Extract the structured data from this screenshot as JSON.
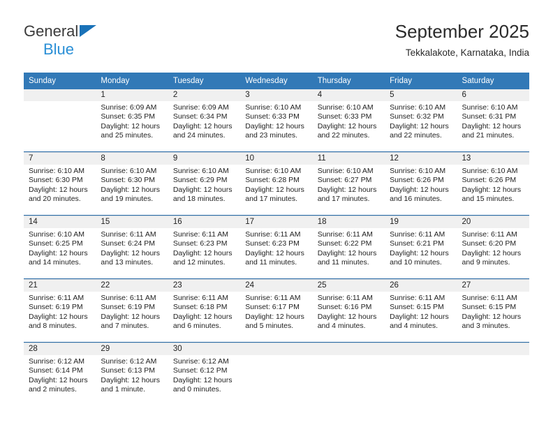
{
  "brand": {
    "name_top": "General",
    "name_bottom": "Blue",
    "triangle_color": "#1a72b8",
    "blue_text_color": "#2a8fd6"
  },
  "header": {
    "title": "September 2025",
    "subtitle": "Tekkalakote, Karnataka, India"
  },
  "theme": {
    "header_row_bg": "#3279b7",
    "header_row_text": "#ffffff",
    "daynum_band_bg": "#f0f0f0",
    "row_divider": "#2a6ca8",
    "cell_border": "#cfd6dc"
  },
  "weekday_headers": [
    "Sunday",
    "Monday",
    "Tuesday",
    "Wednesday",
    "Thursday",
    "Friday",
    "Saturday"
  ],
  "weeks": [
    [
      {
        "day": "",
        "lines": []
      },
      {
        "day": "1",
        "lines": [
          "Sunrise: 6:09 AM",
          "Sunset: 6:35 PM",
          "Daylight: 12 hours",
          "and 25 minutes."
        ]
      },
      {
        "day": "2",
        "lines": [
          "Sunrise: 6:09 AM",
          "Sunset: 6:34 PM",
          "Daylight: 12 hours",
          "and 24 minutes."
        ]
      },
      {
        "day": "3",
        "lines": [
          "Sunrise: 6:10 AM",
          "Sunset: 6:33 PM",
          "Daylight: 12 hours",
          "and 23 minutes."
        ]
      },
      {
        "day": "4",
        "lines": [
          "Sunrise: 6:10 AM",
          "Sunset: 6:33 PM",
          "Daylight: 12 hours",
          "and 22 minutes."
        ]
      },
      {
        "day": "5",
        "lines": [
          "Sunrise: 6:10 AM",
          "Sunset: 6:32 PM",
          "Daylight: 12 hours",
          "and 22 minutes."
        ]
      },
      {
        "day": "6",
        "lines": [
          "Sunrise: 6:10 AM",
          "Sunset: 6:31 PM",
          "Daylight: 12 hours",
          "and 21 minutes."
        ]
      }
    ],
    [
      {
        "day": "7",
        "lines": [
          "Sunrise: 6:10 AM",
          "Sunset: 6:30 PM",
          "Daylight: 12 hours",
          "and 20 minutes."
        ]
      },
      {
        "day": "8",
        "lines": [
          "Sunrise: 6:10 AM",
          "Sunset: 6:30 PM",
          "Daylight: 12 hours",
          "and 19 minutes."
        ]
      },
      {
        "day": "9",
        "lines": [
          "Sunrise: 6:10 AM",
          "Sunset: 6:29 PM",
          "Daylight: 12 hours",
          "and 18 minutes."
        ]
      },
      {
        "day": "10",
        "lines": [
          "Sunrise: 6:10 AM",
          "Sunset: 6:28 PM",
          "Daylight: 12 hours",
          "and 17 minutes."
        ]
      },
      {
        "day": "11",
        "lines": [
          "Sunrise: 6:10 AM",
          "Sunset: 6:27 PM",
          "Daylight: 12 hours",
          "and 17 minutes."
        ]
      },
      {
        "day": "12",
        "lines": [
          "Sunrise: 6:10 AM",
          "Sunset: 6:26 PM",
          "Daylight: 12 hours",
          "and 16 minutes."
        ]
      },
      {
        "day": "13",
        "lines": [
          "Sunrise: 6:10 AM",
          "Sunset: 6:26 PM",
          "Daylight: 12 hours",
          "and 15 minutes."
        ]
      }
    ],
    [
      {
        "day": "14",
        "lines": [
          "Sunrise: 6:10 AM",
          "Sunset: 6:25 PM",
          "Daylight: 12 hours",
          "and 14 minutes."
        ]
      },
      {
        "day": "15",
        "lines": [
          "Sunrise: 6:11 AM",
          "Sunset: 6:24 PM",
          "Daylight: 12 hours",
          "and 13 minutes."
        ]
      },
      {
        "day": "16",
        "lines": [
          "Sunrise: 6:11 AM",
          "Sunset: 6:23 PM",
          "Daylight: 12 hours",
          "and 12 minutes."
        ]
      },
      {
        "day": "17",
        "lines": [
          "Sunrise: 6:11 AM",
          "Sunset: 6:23 PM",
          "Daylight: 12 hours",
          "and 11 minutes."
        ]
      },
      {
        "day": "18",
        "lines": [
          "Sunrise: 6:11 AM",
          "Sunset: 6:22 PM",
          "Daylight: 12 hours",
          "and 11 minutes."
        ]
      },
      {
        "day": "19",
        "lines": [
          "Sunrise: 6:11 AM",
          "Sunset: 6:21 PM",
          "Daylight: 12 hours",
          "and 10 minutes."
        ]
      },
      {
        "day": "20",
        "lines": [
          "Sunrise: 6:11 AM",
          "Sunset: 6:20 PM",
          "Daylight: 12 hours",
          "and 9 minutes."
        ]
      }
    ],
    [
      {
        "day": "21",
        "lines": [
          "Sunrise: 6:11 AM",
          "Sunset: 6:19 PM",
          "Daylight: 12 hours",
          "and 8 minutes."
        ]
      },
      {
        "day": "22",
        "lines": [
          "Sunrise: 6:11 AM",
          "Sunset: 6:19 PM",
          "Daylight: 12 hours",
          "and 7 minutes."
        ]
      },
      {
        "day": "23",
        "lines": [
          "Sunrise: 6:11 AM",
          "Sunset: 6:18 PM",
          "Daylight: 12 hours",
          "and 6 minutes."
        ]
      },
      {
        "day": "24",
        "lines": [
          "Sunrise: 6:11 AM",
          "Sunset: 6:17 PM",
          "Daylight: 12 hours",
          "and 5 minutes."
        ]
      },
      {
        "day": "25",
        "lines": [
          "Sunrise: 6:11 AM",
          "Sunset: 6:16 PM",
          "Daylight: 12 hours",
          "and 4 minutes."
        ]
      },
      {
        "day": "26",
        "lines": [
          "Sunrise: 6:11 AM",
          "Sunset: 6:15 PM",
          "Daylight: 12 hours",
          "and 4 minutes."
        ]
      },
      {
        "day": "27",
        "lines": [
          "Sunrise: 6:11 AM",
          "Sunset: 6:15 PM",
          "Daylight: 12 hours",
          "and 3 minutes."
        ]
      }
    ],
    [
      {
        "day": "28",
        "lines": [
          "Sunrise: 6:12 AM",
          "Sunset: 6:14 PM",
          "Daylight: 12 hours",
          "and 2 minutes."
        ]
      },
      {
        "day": "29",
        "lines": [
          "Sunrise: 6:12 AM",
          "Sunset: 6:13 PM",
          "Daylight: 12 hours",
          "and 1 minute."
        ]
      },
      {
        "day": "30",
        "lines": [
          "Sunrise: 6:12 AM",
          "Sunset: 6:12 PM",
          "Daylight: 12 hours",
          "and 0 minutes."
        ]
      },
      {
        "day": "",
        "lines": []
      },
      {
        "day": "",
        "lines": []
      },
      {
        "day": "",
        "lines": []
      },
      {
        "day": "",
        "lines": []
      }
    ]
  ]
}
